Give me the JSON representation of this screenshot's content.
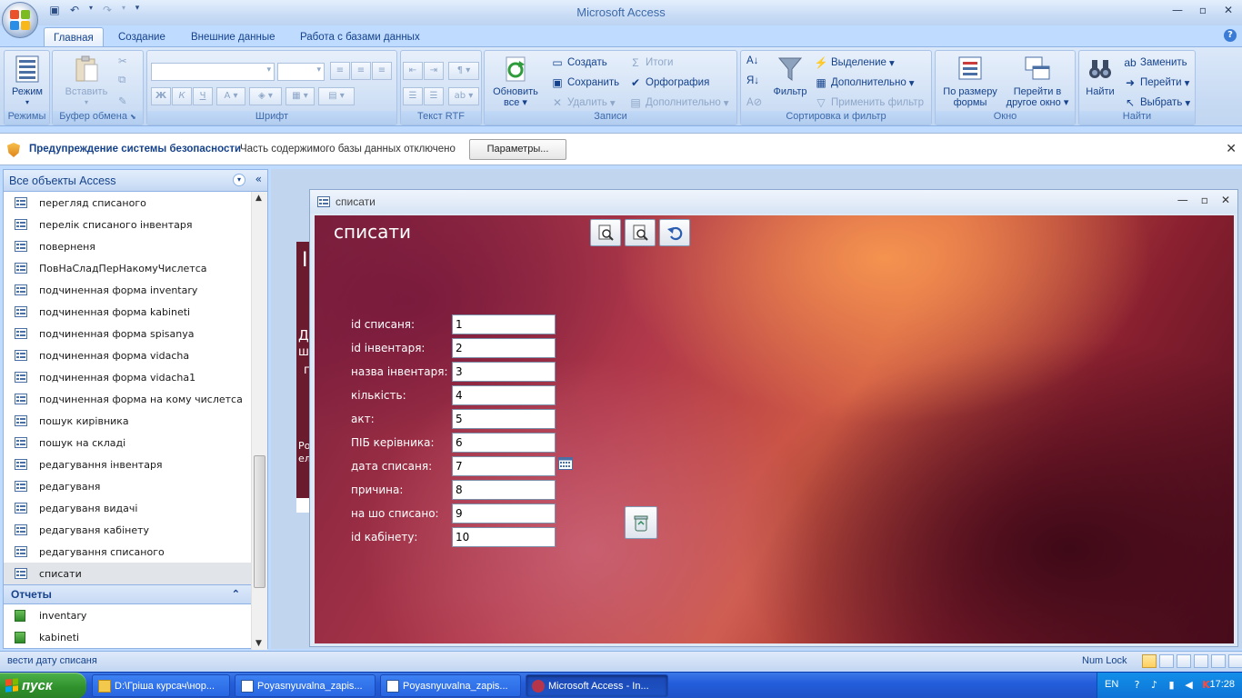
{
  "window": {
    "title": "Microsoft Access",
    "controls": [
      "minimize",
      "maximize",
      "close"
    ]
  },
  "ribbon_tabs": [
    "Главная",
    "Создание",
    "Внешние данные",
    "Работа с базами данных"
  ],
  "ribbon": {
    "groups": {
      "views": "Режимы",
      "clipboard": "Буфер обмена",
      "font": "Шрифт",
      "rtf": "Текст RTF",
      "records": "Записи",
      "sort": "Сортировка и фильтр",
      "window": "Окно",
      "find": "Найти"
    },
    "view_button": "Режим",
    "paste_button": "Вставить",
    "refresh_button_l1": "Обновить",
    "refresh_button_l2": "все",
    "records": {
      "new": "Создать",
      "save": "Сохранить",
      "delete": "Удалить",
      "totals": "Итоги",
      "spelling": "Орфография",
      "more": "Дополнительно"
    },
    "filter_button": "Фильтр",
    "sort": {
      "selection": "Выделение",
      "advanced": "Дополнительно",
      "toggle": "Применить фильтр"
    },
    "window_group": {
      "fit_l1": "По размеру",
      "fit_l2": "формы",
      "switch_l1": "Перейти в",
      "switch_l2": "другое окно"
    },
    "find_button": "Найти",
    "find": {
      "replace": "Заменить",
      "goto": "Перейти",
      "select": "Выбрать"
    }
  },
  "security": {
    "title": "Предупреждение системы безопасности",
    "message": "Часть содержимого базы данных отключено",
    "button": "Параметры..."
  },
  "nav": {
    "header": "Все объекты Access",
    "forms": [
      "перегляд списаного",
      "перелік списаного інвентаря",
      "поверненя",
      "ПовНаСладПерНакомуЧислетса",
      "подчиненная форма inventary",
      "подчиненная форма kabineti",
      "подчиненная форма spisanya",
      "подчиненная форма vidacha",
      "подчиненная форма vidacha1",
      "подчиненная форма на кому числетса",
      "пошук кирівника",
      "пошук на складі",
      "редагування інвентаря",
      "редагуваня",
      "редагуваня видачі",
      "редагуваня кабінету",
      "редагування списаного",
      "списати"
    ],
    "reports_section": "Отчеты",
    "reports": [
      "inventary",
      "kabineti"
    ]
  },
  "background_form": {
    "glyphs": [
      "I",
      "Д",
      "ш",
      "п",
      "Ро",
      "ел"
    ]
  },
  "child": {
    "title": "списати",
    "heading": "списати",
    "fields": [
      {
        "label": "id списаня:",
        "value": "1"
      },
      {
        "label": "id інвентаря:",
        "value": "2"
      },
      {
        "label": "назва інвентаря:",
        "value": "3"
      },
      {
        "label": "кількість:",
        "value": "4"
      },
      {
        "label": "акт:",
        "value": "5"
      },
      {
        "label": "ПІБ керівника:",
        "value": "6"
      },
      {
        "label": "дата списаня:",
        "value": "7"
      },
      {
        "label": "причина:",
        "value": "8"
      },
      {
        "label": "на шо списано:",
        "value": "9"
      },
      {
        "label": "id кабінету:",
        "value": "10"
      }
    ]
  },
  "status": {
    "message": "вести дату списаня",
    "numlock": "Num Lock"
  },
  "taskbar": {
    "start": "пуск",
    "tasks": [
      "D:\\Гріша курсач\\нор...",
      "Poyasnyuvalna_zapis...",
      "Poyasnyuvalna_zapis...",
      "Microsoft Access - In..."
    ],
    "lang": "EN",
    "clock": "17:28"
  }
}
